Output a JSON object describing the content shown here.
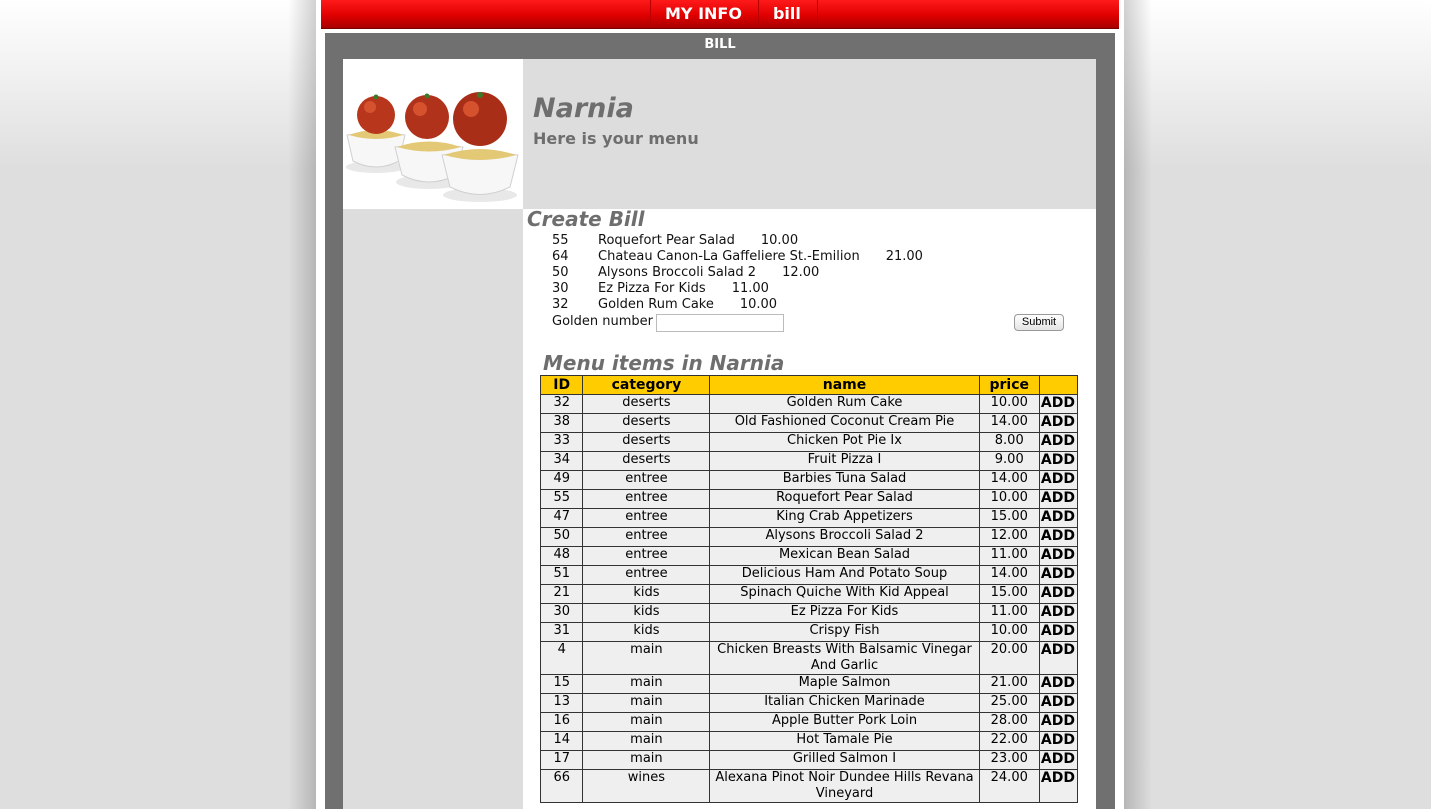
{
  "nav": {
    "items": [
      "MY INFO",
      "bill"
    ]
  },
  "frame": {
    "title": "BILL"
  },
  "banner": {
    "name": "Narnia",
    "subtitle": "Here is your menu",
    "image": "meatball-spaghetti-photo"
  },
  "create_bill": {
    "title": "Create Bill",
    "items": [
      {
        "id": "55",
        "name": "Roquefort Pear Salad",
        "price": "10.00"
      },
      {
        "id": "64",
        "name": "Chateau Canon-La Gaffeliere St.-Emilion",
        "price": "21.00"
      },
      {
        "id": "50",
        "name": "Alysons Broccoli Salad 2",
        "price": "12.00"
      },
      {
        "id": "30",
        "name": "Ez Pizza For Kids",
        "price": "11.00"
      },
      {
        "id": "32",
        "name": "Golden Rum Cake",
        "price": "10.00"
      }
    ],
    "golden_label": "Golden number",
    "golden_value": "",
    "submit_label": "Submit"
  },
  "menu": {
    "title": "Menu items in Narnia",
    "columns": [
      "ID",
      "category",
      "name",
      "price",
      ""
    ],
    "add_label": "ADD",
    "rows": [
      {
        "id": "32",
        "category": "deserts",
        "name": "Golden Rum Cake",
        "price": "10.00"
      },
      {
        "id": "38",
        "category": "deserts",
        "name": "Old Fashioned Coconut Cream Pie",
        "price": "14.00"
      },
      {
        "id": "33",
        "category": "deserts",
        "name": "Chicken Pot Pie Ix",
        "price": "8.00"
      },
      {
        "id": "34",
        "category": "deserts",
        "name": "Fruit Pizza I",
        "price": "9.00"
      },
      {
        "id": "49",
        "category": "entree",
        "name": "Barbies Tuna Salad",
        "price": "14.00"
      },
      {
        "id": "55",
        "category": "entree",
        "name": "Roquefort Pear Salad",
        "price": "10.00"
      },
      {
        "id": "47",
        "category": "entree",
        "name": "King Crab Appetizers",
        "price": "15.00"
      },
      {
        "id": "50",
        "category": "entree",
        "name": "Alysons Broccoli Salad 2",
        "price": "12.00"
      },
      {
        "id": "48",
        "category": "entree",
        "name": "Mexican Bean Salad",
        "price": "11.00"
      },
      {
        "id": "51",
        "category": "entree",
        "name": "Delicious Ham And Potato Soup",
        "price": "14.00"
      },
      {
        "id": "21",
        "category": "kids",
        "name": "Spinach Quiche With Kid Appeal",
        "price": "15.00"
      },
      {
        "id": "30",
        "category": "kids",
        "name": "Ez Pizza For Kids",
        "price": "11.00"
      },
      {
        "id": "31",
        "category": "kids",
        "name": "Crispy Fish",
        "price": "10.00"
      },
      {
        "id": "4",
        "category": "main",
        "name": "Chicken Breasts With Balsamic Vinegar And Garlic",
        "price": "20.00"
      },
      {
        "id": "15",
        "category": "main",
        "name": "Maple Salmon",
        "price": "21.00"
      },
      {
        "id": "13",
        "category": "main",
        "name": "Italian Chicken Marinade",
        "price": "25.00"
      },
      {
        "id": "16",
        "category": "main",
        "name": "Apple Butter Pork Loin",
        "price": "28.00"
      },
      {
        "id": "14",
        "category": "main",
        "name": "Hot Tamale Pie",
        "price": "22.00"
      },
      {
        "id": "17",
        "category": "main",
        "name": "Grilled Salmon I",
        "price": "23.00"
      },
      {
        "id": "66",
        "category": "wines",
        "name": "Alexana Pinot Noir Dundee Hills Revana Vineyard",
        "price": "24.00"
      }
    ]
  }
}
